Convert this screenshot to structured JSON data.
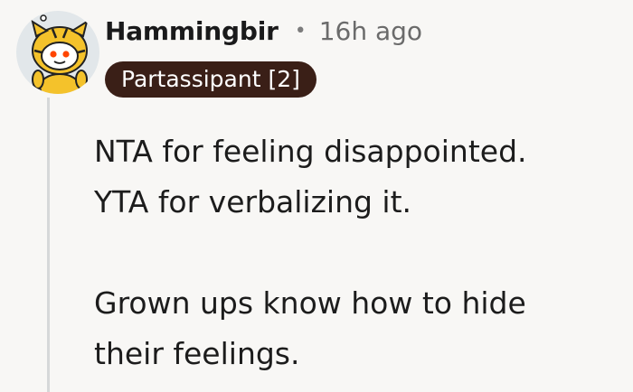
{
  "comment": {
    "username": "Hammingbir",
    "separator": "•",
    "timestamp": "16h ago",
    "flair": "Partassipant [2]",
    "avatar_icon": "snoo-tiger-costume-avatar",
    "body": {
      "lines": [
        "NTA for feeling disappointed.",
        "YTA for verbalizing it.",
        "",
        "Grown ups know how to hide",
        "their feelings."
      ]
    }
  },
  "colors": {
    "background": "#f8f7f5",
    "flair_bg": "#3a1f17",
    "flair_text": "#ffffff",
    "thread_line": "#d6d8d9",
    "avatar_costume": "#f4c22b",
    "avatar_eyes": "#ff4500"
  }
}
